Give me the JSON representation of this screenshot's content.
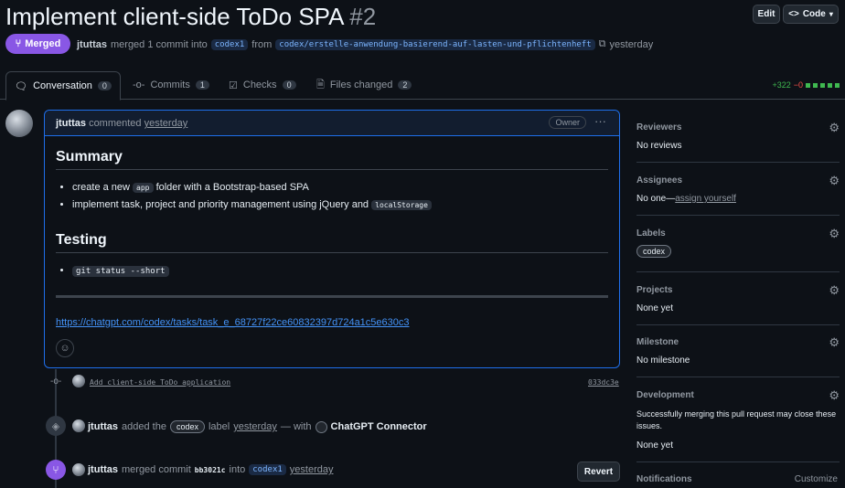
{
  "pr": {
    "title": "Implement client-side ToDo SPA",
    "number": "#2",
    "status": "Merged",
    "author": "jtuttas",
    "merge_text": "merged 1 commit into",
    "base_branch": "codex1",
    "from_text": "from",
    "head_branch": "codex/erstelle-anwendung-basierend-auf-lasten-und-pflichtenheft",
    "time": "yesterday"
  },
  "header_buttons": {
    "edit": "Edit",
    "code": "Code"
  },
  "tabs": [
    {
      "label": "Conversation",
      "count": "0",
      "icon": "comment-icon"
    },
    {
      "label": "Commits",
      "count": "1",
      "icon": "commit-icon"
    },
    {
      "label": "Checks",
      "count": "0",
      "icon": "checklist-icon"
    },
    {
      "label": "Files changed",
      "count": "2",
      "icon": "file-diff-icon"
    }
  ],
  "diffstat": {
    "additions": "+322",
    "deletions": "−0"
  },
  "comment": {
    "author": "jtuttas",
    "verb": "commented",
    "time": "yesterday",
    "role": "Owner",
    "summary_heading": "Summary",
    "summary_items": [
      {
        "pre": "create a new",
        "code": "app",
        "post": "folder with a Bootstrap-based SPA"
      },
      {
        "pre": "implement task, project and priority management using jQuery and",
        "code": "localStorage",
        "post": ""
      }
    ],
    "testing_heading": "Testing",
    "testing_items": [
      {
        "code": "git status --short"
      }
    ],
    "link": "https://chatgpt.com/codex/tasks/task_e_68727f22ce60832397d724a1c5e630c3"
  },
  "timeline": {
    "commit": {
      "message": "Add client-side ToDo application",
      "sha": "033dc3e"
    },
    "label_event": {
      "actor": "jtuttas",
      "pre": "added the",
      "label": "codex",
      "post": "label",
      "time": "yesterday",
      "with": "— with",
      "app": "ChatGPT Connector"
    },
    "merge_event": {
      "actor": "jtuttas",
      "pre": "merged commit",
      "sha": "bb3021c",
      "into": "into",
      "branch": "codex1",
      "time": "yesterday",
      "revert": "Revert"
    }
  },
  "sidebar": {
    "reviewers": {
      "heading": "Reviewers",
      "value": "No reviews"
    },
    "assignees": {
      "heading": "Assignees",
      "value": "No one—",
      "action": "assign yourself"
    },
    "labels": {
      "heading": "Labels",
      "value": "codex"
    },
    "projects": {
      "heading": "Projects",
      "value": "None yet"
    },
    "milestone": {
      "heading": "Milestone",
      "value": "No milestone"
    },
    "development": {
      "heading": "Development",
      "text": "Successfully merging this pull request may close these issues.",
      "value": "None yet"
    },
    "notifications": {
      "heading": "Notifications",
      "action": "Customize"
    }
  },
  "colors": {
    "merged": "#8957e5",
    "link": "#4493f8",
    "added": "#3fb950",
    "deleted": "#f85149"
  }
}
